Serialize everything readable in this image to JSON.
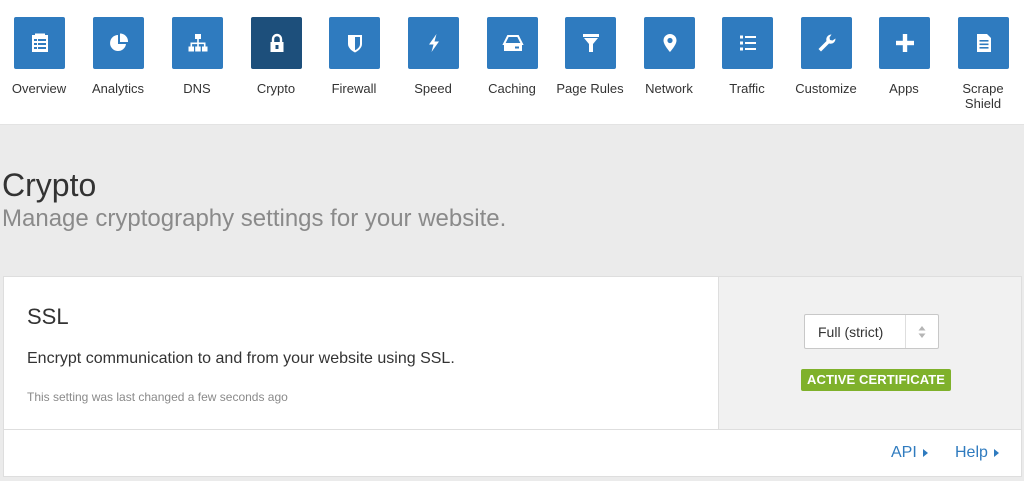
{
  "nav": {
    "items": [
      {
        "label": "Overview",
        "icon": "overview-icon"
      },
      {
        "label": "Analytics",
        "icon": "pie-chart-icon"
      },
      {
        "label": "DNS",
        "icon": "network-tree-icon"
      },
      {
        "label": "Crypto",
        "icon": "lock-icon",
        "active": true
      },
      {
        "label": "Firewall",
        "icon": "shield-icon"
      },
      {
        "label": "Speed",
        "icon": "lightning-icon"
      },
      {
        "label": "Caching",
        "icon": "hard-drive-icon"
      },
      {
        "label": "Page Rules",
        "icon": "filter-icon"
      },
      {
        "label": "Network",
        "icon": "location-pin-icon"
      },
      {
        "label": "Traffic",
        "icon": "list-icon"
      },
      {
        "label": "Customize",
        "icon": "wrench-icon"
      },
      {
        "label": "Apps",
        "icon": "plus-icon"
      },
      {
        "label": "Scrape Shield",
        "label_lines": [
          "Scrape",
          "Shield"
        ],
        "icon": "document-icon"
      }
    ]
  },
  "page": {
    "title": "Crypto",
    "subtitle": "Manage cryptography settings for your website."
  },
  "ssl_card": {
    "title": "SSL",
    "description": "Encrypt communication to and from your website using SSL.",
    "meta": "This setting was last changed a few seconds ago",
    "select_value": "Full (strict)",
    "badge": "ACTIVE CERTIFICATE",
    "api_link": "API",
    "help_link": "Help"
  },
  "colors": {
    "nav_icon_bg": "#2f7bbf",
    "nav_icon_active_bg": "#1d4f7b",
    "badge_bg": "#7fb12b",
    "link": "#2f7bbf"
  }
}
